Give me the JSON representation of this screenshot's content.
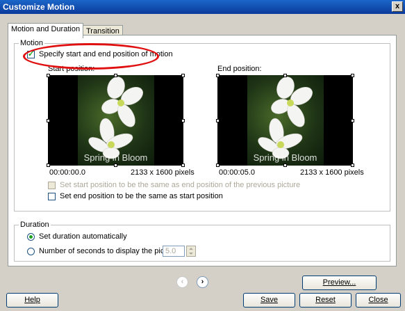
{
  "window": {
    "title": "Customize Motion",
    "close_glyph": "x"
  },
  "tabs": [
    {
      "label": "Motion and Duration"
    },
    {
      "label": "Transition"
    }
  ],
  "motion": {
    "group_label": "Motion",
    "specify_checkbox": {
      "label": "Specify start and end position of motion",
      "checked": true
    },
    "start": {
      "heading": "Start position:",
      "caption": "Spring in Bloom",
      "time": "00:00:00.0",
      "size": "2133 x 1600 pixels"
    },
    "end": {
      "heading": "End position:",
      "caption": "Spring in Bloom",
      "time": "00:00:05.0",
      "size": "2133 x 1600 pixels"
    },
    "same_as_previous": {
      "label": "Set start position to be the same as end position of the previous picture",
      "checked": false,
      "disabled": true
    },
    "same_as_start": {
      "label": "Set end position to be the same as start position",
      "checked": false
    }
  },
  "duration": {
    "group_label": "Duration",
    "auto": {
      "label": "Set duration automatically",
      "selected": true
    },
    "seconds": {
      "label": "Number of seconds to display the picture",
      "selected": false,
      "value": "5.0"
    }
  },
  "nav": {
    "prev_glyph": "‹",
    "next_glyph": "›"
  },
  "buttons": {
    "preview": "Preview...",
    "help": "Help",
    "save": "Save",
    "reset": "Reset",
    "close": "Close"
  },
  "colors": {
    "title_bar": "#0a3a9a",
    "annotation": "#e01010"
  }
}
